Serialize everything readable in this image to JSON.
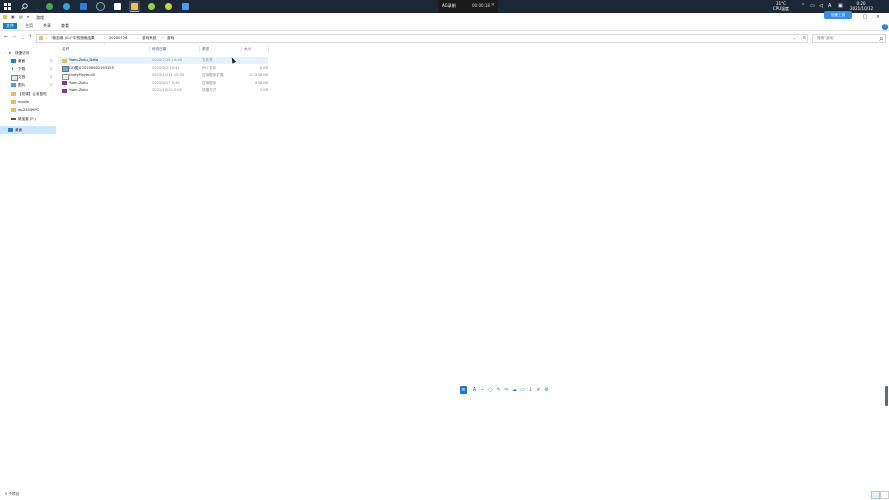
{
  "taskbar": {
    "weather_temp": "31°C",
    "weather_desc": "CPU温度",
    "time": "0:20",
    "date": "2021/10/12",
    "lang": "A"
  },
  "recorder": {
    "title": "AG录制",
    "elapsed": "00:00:18",
    "close": "×"
  },
  "window": {
    "title": "游戏",
    "float_label": "加速工具"
  },
  "ribbon": {
    "tabs": [
      "文件",
      "主页",
      "共享",
      "查看"
    ]
  },
  "address": {
    "crumbs": [
      "\"新加卷 (G:)\"中的搜索结果",
      "20200726",
      "游戏系统",
      "游戏"
    ],
    "search_placeholder": "搜索\"游戏\""
  },
  "nav": {
    "items": [
      {
        "label": "快速访问",
        "pin": ""
      },
      {
        "label": "桌面",
        "pin": "📌"
      },
      {
        "label": "下载",
        "pin": "📌"
      },
      {
        "label": "文档",
        "pin": "📌"
      },
      {
        "label": "图片",
        "pin": "📌"
      },
      {
        "label": "【初课】让老鼠吃",
        "pin": ""
      },
      {
        "label": "movie",
        "pin": ""
      },
      {
        "label": "wc25439PC",
        "pin": ""
      },
      {
        "label": "新加卷 (F:)",
        "pin": ""
      },
      {
        "label": "桌面",
        "pin": ""
      }
    ]
  },
  "files": {
    "columns": {
      "name": "名称",
      "date": "修改日期",
      "type": "类型",
      "size": "大小"
    },
    "rows": [
      {
        "name": "Yuen-Zoku_Data",
        "date": "2020/7/25 19:58",
        "type": "文件夹",
        "size": ""
      },
      {
        "name": "QQ图片20200602193155",
        "date": "2020/6/2 19:31",
        "type": "JPG 文件",
        "size": "8 KB"
      },
      {
        "name": "UnityPlayer.dll",
        "date": "2019/12/11 10:03",
        "type": "应用程序扩展",
        "size": "21,836 KB"
      },
      {
        "name": "Yuen-Zoku",
        "date": "2020/6/17 9:34",
        "type": "应用程序",
        "size": "636 KB"
      },
      {
        "name": "Yuen-Zoku",
        "date": "2021/10/12 0:05",
        "type": "快捷方式",
        "size": "2 KB"
      }
    ]
  },
  "status": {
    "text": "5 个项目"
  },
  "colors": {
    "accent": "#1979ca",
    "taskbar": "#1c2838",
    "selection": "#cce8ff",
    "folder": "#e8c05a"
  }
}
